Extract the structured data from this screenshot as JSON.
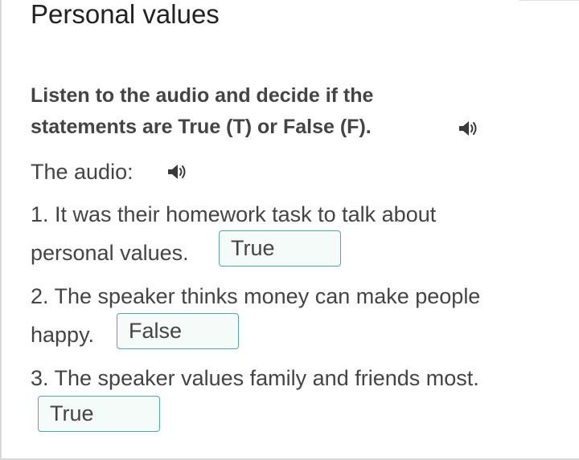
{
  "page": {
    "title": "Personal values"
  },
  "instruction": {
    "line1": "Listen to the audio and decide if the",
    "line2": "statements are True (T) or False (F)."
  },
  "audio": {
    "label": "The audio:",
    "icon": "speaker-icon"
  },
  "questions": [
    {
      "line1": "1. It was their homework task to talk about",
      "line2": "personal values.",
      "answer": "True"
    },
    {
      "line1": "2. The speaker thinks money can make people",
      "line2": "happy.",
      "answer": "False"
    },
    {
      "line1": "3. The speaker values family and friends most.",
      "answer": "True"
    }
  ],
  "colors": {
    "answer_border": "#5aa89a",
    "answer_background": "#f4fbf8",
    "text": "#444444"
  }
}
